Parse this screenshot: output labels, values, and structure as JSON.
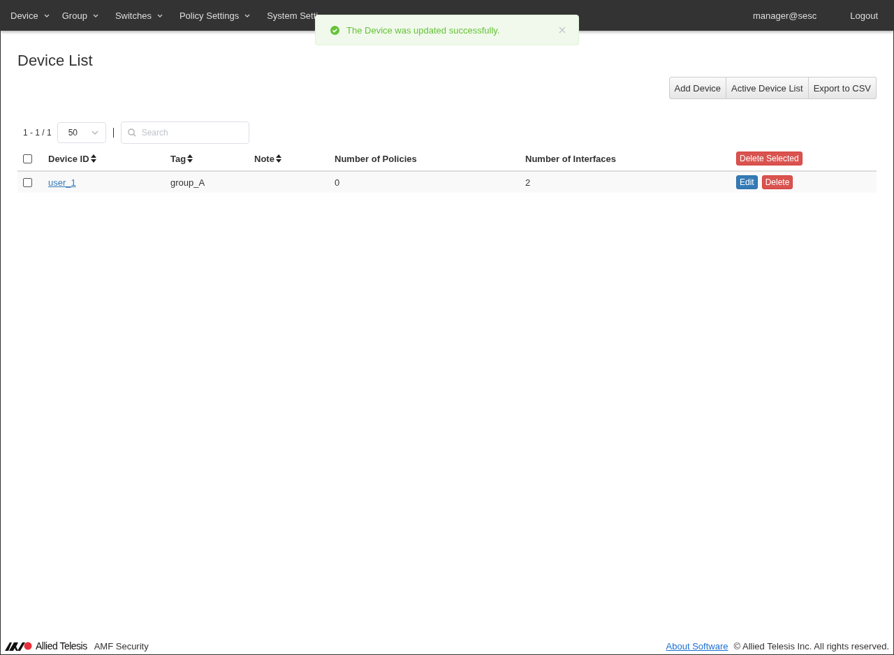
{
  "nav": {
    "items": [
      {
        "label": "Device",
        "dropdown": true
      },
      {
        "label": "Group",
        "dropdown": true
      },
      {
        "label": "Switches",
        "dropdown": true
      },
      {
        "label": "Policy Settings",
        "dropdown": true
      },
      {
        "label": "System Setti",
        "dropdown": false
      }
    ],
    "user": "manager@sesc",
    "logout": "Logout"
  },
  "toast": {
    "message": "The Device was updated successfully."
  },
  "page_title": "Device List",
  "actions": [
    "Add Device",
    "Active Device List",
    "Export to CSV"
  ],
  "pagination": {
    "range": "1 - 1 / 1",
    "page_size": "50",
    "search_placeholder": "Search"
  },
  "table": {
    "select_all_checked": false,
    "columns": [
      {
        "label": "Device ID",
        "sortable": true
      },
      {
        "label": "Tag",
        "sortable": true
      },
      {
        "label": "Note",
        "sortable": true
      },
      {
        "label": "Number of Policies",
        "sortable": false
      },
      {
        "label": "Number of Interfaces",
        "sortable": false
      }
    ],
    "delete_selected": "Delete Selected",
    "rows": [
      {
        "checked": false,
        "device_id": "user_1",
        "tag": "group_A",
        "note": "",
        "policies": "0",
        "interfaces": "2",
        "edit": "Edit",
        "delete": "Delete"
      }
    ]
  },
  "footer": {
    "brand": "Allied Telesis",
    "product": "AMF Security",
    "about": "About Software",
    "copyright": "© Allied Telesis Inc. All rights reserved."
  }
}
